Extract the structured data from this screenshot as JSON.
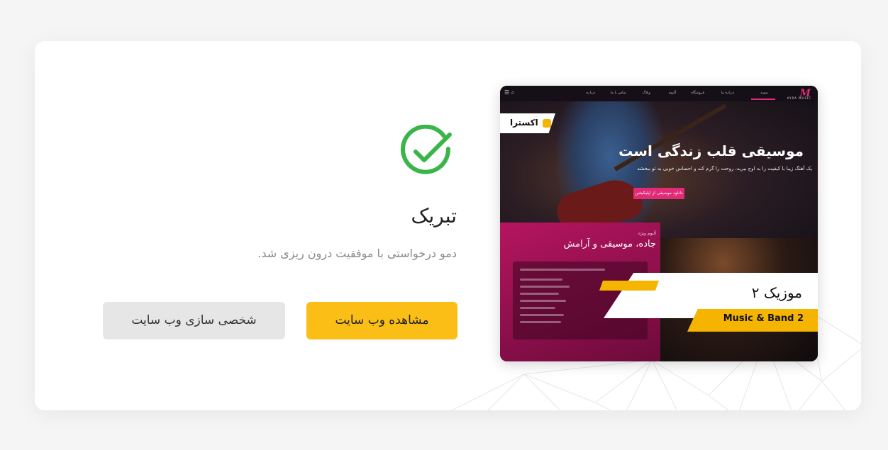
{
  "result": {
    "title": "تبریک",
    "message": "دمو درخواستی با موفقیت درون ریزی شد."
  },
  "buttons": {
    "view_website": "مشاهده وب سایت",
    "customize_website": "شخصی سازی وب سایت"
  },
  "preview": {
    "brand_badge": "اکسترا",
    "logo_text": "M",
    "logo_sub": "AYRA MUSIC",
    "nav_items": [
      "نمونه",
      "درباره ما",
      "فروشگاه",
      "آلبوم",
      "وبلاگ",
      "تماس با ما",
      "درباره"
    ],
    "hero_title": "موسیقی قلب زندگی است",
    "hero_subtitle": "یک آهنگ زیبا با کیفیت را به اوج ببرید، روحت را گرم کند و احساس خوبی به تو ببخشد",
    "hero_cta": "دانلود موسیقی از اپلیکیشن",
    "section_kicker": "آلبوم ویژه",
    "section_title": "جاده، موسیقی و آرامش",
    "demo_name": "موزیک ۲",
    "demo_name_en": "Music & Band 2"
  },
  "colors": {
    "accent": "#fbbe16",
    "success": "#3bb54a",
    "preview_pink": "#b5155f"
  },
  "icons": {
    "check": "check-circle-icon"
  }
}
